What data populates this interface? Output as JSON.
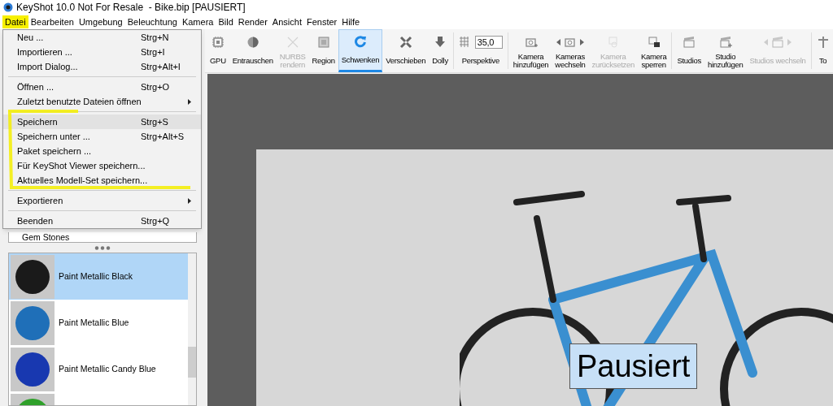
{
  "window": {
    "title": "KeyShot 10.0 Not For Resale  - Bike.bip [PAUSIERT]"
  },
  "menu_bar": [
    {
      "label": "Datei",
      "selected": true
    },
    {
      "label": "Bearbeiten",
      "selected": false
    },
    {
      "label": "Umgebung",
      "selected": false
    },
    {
      "label": "Beleuchtung",
      "selected": false
    },
    {
      "label": "Kamera",
      "selected": false
    },
    {
      "label": "Bild",
      "selected": false
    },
    {
      "label": "Render",
      "selected": false
    },
    {
      "label": "Ansicht",
      "selected": false
    },
    {
      "label": "Fenster",
      "selected": false
    },
    {
      "label": "Hilfe",
      "selected": false
    }
  ],
  "file_menu": [
    {
      "kind": "item",
      "label": "Neu ...",
      "shortcut": "Strg+N",
      "submenu": false,
      "highlighted": false
    },
    {
      "kind": "item",
      "label": "Importieren ...",
      "shortcut": "Strg+I",
      "submenu": false,
      "highlighted": false
    },
    {
      "kind": "item",
      "label": "Import Dialog...",
      "shortcut": "Strg+Alt+I",
      "submenu": false,
      "highlighted": false
    },
    {
      "kind": "separator"
    },
    {
      "kind": "item",
      "label": "Öffnen ...",
      "shortcut": "Strg+O",
      "submenu": false,
      "highlighted": false
    },
    {
      "kind": "item",
      "label": "Zuletzt benutzte Dateien öffnen",
      "submenu": true,
      "highlighted": false
    },
    {
      "kind": "separator"
    },
    {
      "kind": "item",
      "label": "Speichern",
      "shortcut": "Strg+S",
      "submenu": false,
      "highlighted": true
    },
    {
      "kind": "item",
      "label": "Speichern unter ...",
      "shortcut": "Strg+Alt+S",
      "submenu": false,
      "highlighted": false
    },
    {
      "kind": "item",
      "label": "Paket speichern ...",
      "submenu": false,
      "highlighted": false
    },
    {
      "kind": "item",
      "label": "Für KeyShot Viewer speichern...",
      "submenu": false,
      "highlighted": false
    },
    {
      "kind": "item",
      "label": "Aktuelles Modell-Set speichern...",
      "submenu": false,
      "highlighted": false
    },
    {
      "kind": "separator"
    },
    {
      "kind": "item",
      "label": "Exportieren",
      "submenu": true,
      "highlighted": false
    },
    {
      "kind": "separator"
    },
    {
      "kind": "item",
      "label": "Beenden",
      "shortcut": "Strg+Q",
      "submenu": false,
      "highlighted": false
    }
  ],
  "toolbar": [
    {
      "kind": "button",
      "label": "GPU",
      "disabled": false,
      "selected": false
    },
    {
      "kind": "button",
      "label": "Entrauschen",
      "disabled": false,
      "selected": false
    },
    {
      "kind": "button",
      "label": "NURBS rendern",
      "disabled": true,
      "selected": false
    },
    {
      "kind": "button",
      "label": "Region",
      "disabled": false,
      "selected": false
    },
    {
      "kind": "button",
      "label": "Schwenken",
      "disabled": false,
      "selected": true
    },
    {
      "kind": "button",
      "label": "Verschieben",
      "disabled": false,
      "selected": false
    },
    {
      "kind": "button",
      "label": "Dolly",
      "disabled": false,
      "selected": false
    },
    {
      "kind": "field",
      "label": "Perspektive",
      "value": "35,0",
      "disabled": false,
      "selected": false
    },
    {
      "kind": "button",
      "label": "Kamera hinzufügen",
      "disabled": false,
      "selected": false
    },
    {
      "kind": "switcher",
      "label": "Kameras wechseln",
      "disabled": false,
      "selected": false
    },
    {
      "kind": "button",
      "label": "Kamera zurücksetzen",
      "disabled": true,
      "selected": false
    },
    {
      "kind": "button",
      "label": "Kamera sperren",
      "disabled": false,
      "selected": false
    },
    {
      "kind": "button",
      "label": "Studios",
      "disabled": false,
      "selected": false
    },
    {
      "kind": "button",
      "label": "Studio hinzufügen",
      "disabled": false,
      "selected": false
    },
    {
      "kind": "switcher",
      "label": "Studios wechseln",
      "disabled": true,
      "selected": false
    },
    {
      "kind": "button",
      "label": "To",
      "disabled": false,
      "selected": false
    }
  ],
  "tree": [
    {
      "label": "Gem Stones"
    }
  ],
  "materials": [
    {
      "label": "Paint Metallic Black",
      "color": "#1a1a1a",
      "selected": true
    },
    {
      "label": "Paint Metallic Blue",
      "color": "#1f6fb8",
      "selected": false
    },
    {
      "label": "Paint Metallic Candy Blue",
      "color": "#1838b0",
      "selected": false
    },
    {
      "color": "#2fa02a",
      "selected": false
    }
  ],
  "viewport": {
    "status": "Pausiert"
  }
}
